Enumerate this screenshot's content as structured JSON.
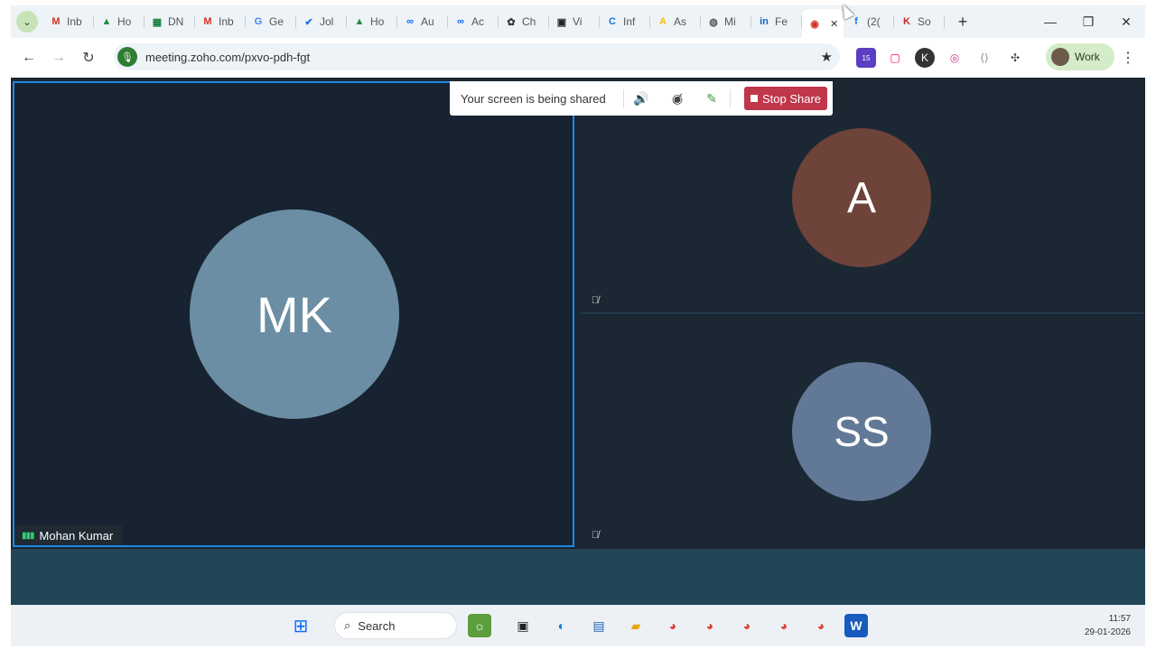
{
  "browser": {
    "tabs": [
      {
        "label": "Inb",
        "icon": "gmail-icon",
        "color": "#d93025",
        "glyph": "M"
      },
      {
        "label": "Ho",
        "icon": "google-drive-icon",
        "color": "#1e8e3e",
        "glyph": "▲"
      },
      {
        "label": "DN",
        "icon": "google-sheets-icon",
        "color": "#188038",
        "glyph": "▦"
      },
      {
        "label": "Inb",
        "icon": "gmail-icon",
        "color": "#d93025",
        "glyph": "M"
      },
      {
        "label": "Ge",
        "icon": "google-icon",
        "color": "#4285f4",
        "glyph": "G"
      },
      {
        "label": "Jol",
        "icon": "checkmark-icon",
        "color": "#1a73e8",
        "glyph": "✔"
      },
      {
        "label": "Ho",
        "icon": "google-drive-icon",
        "color": "#1e8e3e",
        "glyph": "▲"
      },
      {
        "label": "Au",
        "icon": "meta-icon",
        "color": "#0866ff",
        "glyph": "∞"
      },
      {
        "label": "Ac",
        "icon": "meta-icon",
        "color": "#0866ff",
        "glyph": "∞"
      },
      {
        "label": "Ch",
        "icon": "chatgpt-icon",
        "color": "#333333",
        "glyph": "✿"
      },
      {
        "label": "Vi",
        "icon": "video-app-icon",
        "color": "#222222",
        "glyph": "▣"
      },
      {
        "label": "Inf",
        "icon": "circle-c-icon",
        "color": "#1a73e8",
        "glyph": "C"
      },
      {
        "label": "As",
        "icon": "google-ads-icon",
        "color": "#fbbc04",
        "glyph": "A"
      },
      {
        "label": "Mi",
        "icon": "globe-icon",
        "color": "#555555",
        "glyph": "◍"
      },
      {
        "label": "Fe",
        "icon": "linkedin-icon",
        "color": "#0a66c2",
        "glyph": "in"
      },
      {
        "label": "",
        "icon": "zoho-meeting-record-icon",
        "color": "#d93025",
        "glyph": "◉",
        "active": true
      },
      {
        "label": "(2(",
        "icon": "facebook-icon",
        "color": "#1877f2",
        "glyph": "f"
      },
      {
        "label": "So",
        "icon": "app-k-icon",
        "color": "#c62828",
        "glyph": "K"
      }
    ],
    "url": "meeting.zoho.com/pxvo-pdh-fgt",
    "profile_label": "Work",
    "extension_badge": "15"
  },
  "share_bar": {
    "status_text": "Your screen is being shared",
    "stop_label": "Stop Share"
  },
  "participants": [
    {
      "initials": "MK",
      "name": "Mohan Kumar",
      "avatar_color": "#6b8ea4"
    },
    {
      "initials": "A",
      "avatar_color": "#6e4339"
    },
    {
      "initials": "SS",
      "avatar_color": "#627897"
    }
  ],
  "taskbar": {
    "search_label": "Search",
    "time": "11:57",
    "date": "29-01-2026"
  }
}
